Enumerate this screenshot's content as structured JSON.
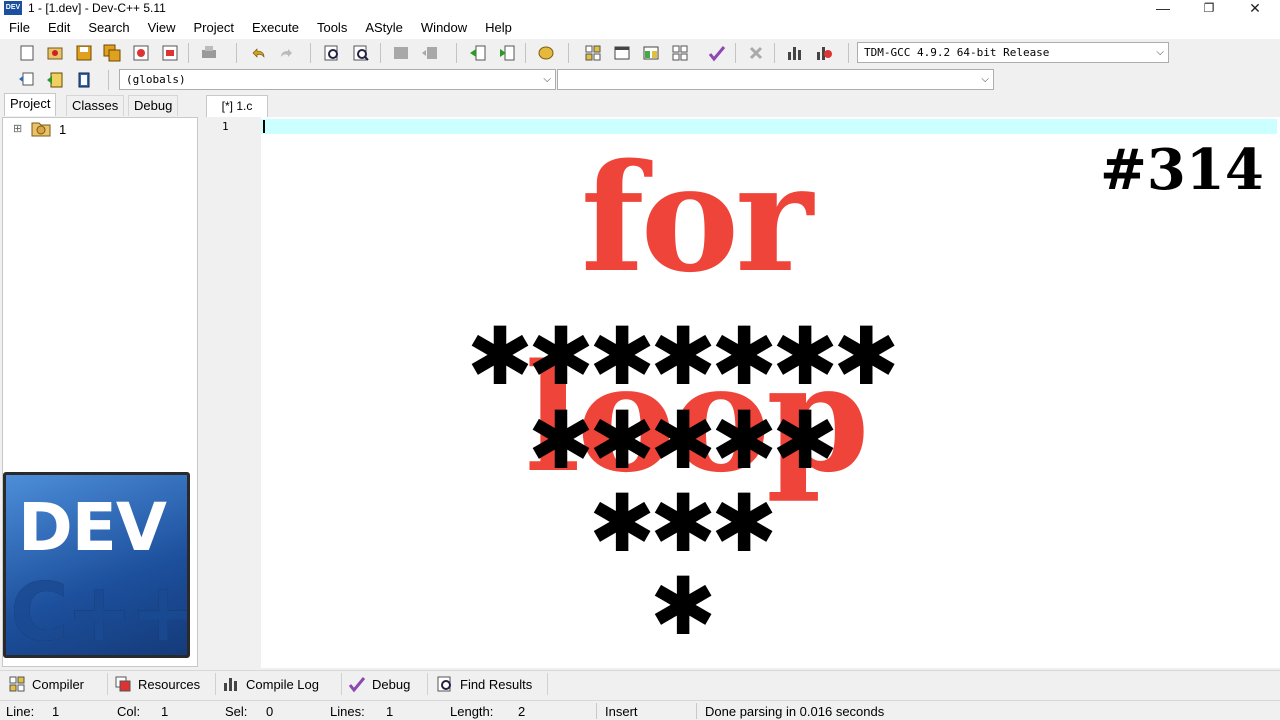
{
  "window": {
    "title": "1 - [1.dev] - Dev-C++ 5.11",
    "app_icon_text": "DEV",
    "minimize": "—",
    "restore": "❐",
    "close": "✕"
  },
  "menu": [
    "File",
    "Edit",
    "Search",
    "View",
    "Project",
    "Execute",
    "Tools",
    "AStyle",
    "Window",
    "Help"
  ],
  "toolbar": {
    "compiler_select": "TDM-GCC 4.9.2 64-bit Release",
    "scope_select": "(globals)",
    "function_select": ""
  },
  "left_panel": {
    "tabs": [
      "Project",
      "Classes",
      "Debug"
    ],
    "tree_expand": "⊞",
    "tree_item": "1"
  },
  "editor": {
    "tab_label": "[*] 1.c",
    "line_number": "1"
  },
  "overlay": {
    "title": "for loop",
    "number": "#314",
    "star_rows": [
      "✱✱✱✱✱✱✱",
      "✱✱✱✱✱",
      "✱✱✱",
      "✱"
    ],
    "logo_line1": "DEV",
    "logo_line2": "C++"
  },
  "bottom_tabs": [
    "Compiler",
    "Resources",
    "Compile Log",
    "Debug",
    "Find Results"
  ],
  "status": {
    "line_label": "Line:",
    "line_value": "1",
    "col_label": "Col:",
    "col_value": "1",
    "sel_label": "Sel:",
    "sel_value": "0",
    "lines_label": "Lines:",
    "lines_value": "1",
    "length_label": "Length:",
    "length_value": "2",
    "mode": "Insert",
    "message": "Done parsing in 0.016 seconds"
  },
  "colors": {
    "overlay_title": "#ee443a",
    "current_line": "#ccffff",
    "logo_blue": "#1c4f9c"
  }
}
